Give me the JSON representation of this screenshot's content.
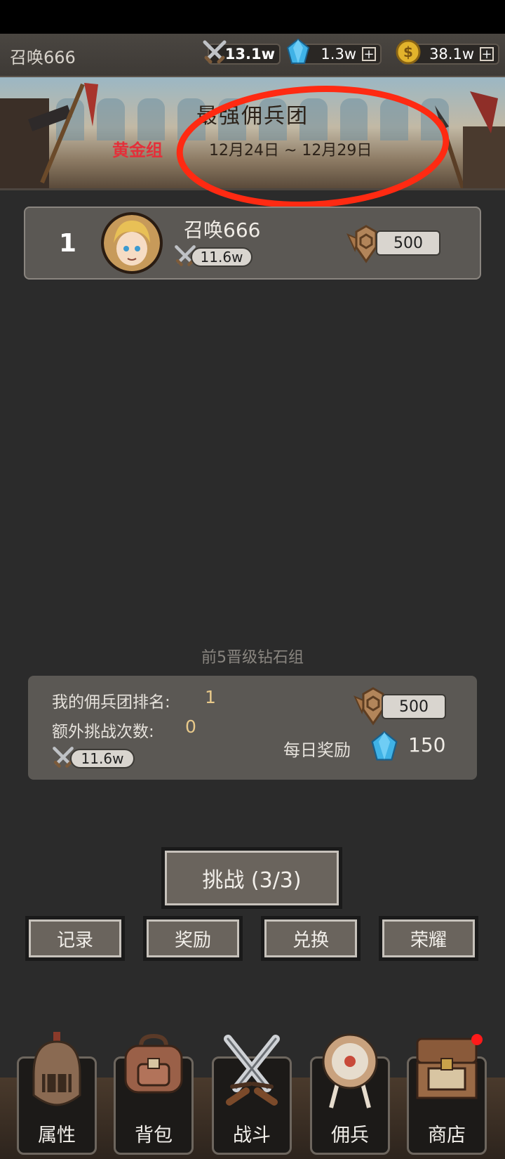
{
  "header": {
    "player_name": "召唤666",
    "resources": [
      {
        "name": "power",
        "icon": "crossed-swords-icon",
        "value": "13.1w"
      },
      {
        "name": "diamond",
        "icon": "diamond-icon",
        "value": "1.3w",
        "plus": "+"
      },
      {
        "name": "gold",
        "icon": "gold-coin-icon",
        "value": "38.1w",
        "plus": "+"
      }
    ]
  },
  "banner": {
    "title": "最强佣兵团",
    "group": "黄金组",
    "date_range": "12月24日 ~ 12月29日"
  },
  "ranking": [
    {
      "rank": "1",
      "name": "召唤666",
      "power": "11.6w",
      "score": "500"
    }
  ],
  "promotion_note": "前5晋级钻石组",
  "my_info": {
    "rank_label": "我的佣兵团排名:",
    "rank_value": "1",
    "extra_label": "额外挑战次数:",
    "extra_value": "0",
    "power": "11.6w",
    "score": "500",
    "daily_label": "每日奖励",
    "daily_value": "150"
  },
  "actions": {
    "challenge": "挑战 (3/3)",
    "record": "记录",
    "reward": "奖励",
    "exchange": "兑换",
    "glory": "荣耀"
  },
  "nav": [
    {
      "label": "属性",
      "icon": "helmet-icon"
    },
    {
      "label": "背包",
      "icon": "backpack-icon"
    },
    {
      "label": "战斗",
      "icon": "crossed-swords-icon"
    },
    {
      "label": "佣兵",
      "icon": "target-icon"
    },
    {
      "label": "商店",
      "icon": "chest-icon"
    }
  ],
  "colors": {
    "accent_red": "#e3303a",
    "annotation_red": "#ff2a12",
    "score_gold": "#e8c98a",
    "panel": "#5b5854"
  }
}
